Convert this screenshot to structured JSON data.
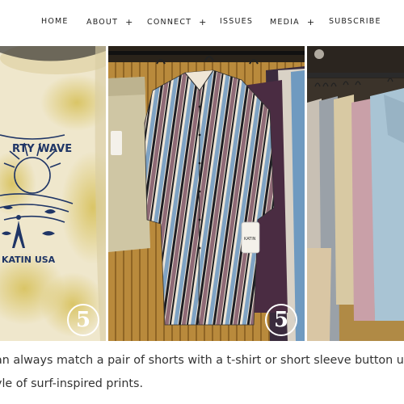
{
  "nav": {
    "items": [
      {
        "label": "HOME",
        "has_submenu": false
      },
      {
        "label": "ABOUT",
        "has_submenu": true
      },
      {
        "label": "CONNECT",
        "has_submenu": true
      },
      {
        "label": "ISSUES",
        "has_submenu": false
      },
      {
        "label": "MEDIA",
        "has_submenu": true
      },
      {
        "label": "SUBSCRIBE",
        "has_submenu": false
      }
    ],
    "submenu_glyph": "+"
  },
  "photos": [
    {
      "alt": "tie-dyed t-shirt",
      "shirt_text_top": "RTY WAVE",
      "shirt_text_bottom": "KATIN USA",
      "badge": "5"
    },
    {
      "alt": "striped button-up shirt on rack",
      "tag_text": "KATIN",
      "badge": "5"
    },
    {
      "alt": "pastel shirts on rack"
    }
  ],
  "caption": {
    "line1": "an always match a pair of shorts with a t-shirt or short sleeve button up that K",
    "line2": "yle of surf-inspired prints."
  },
  "colors": {
    "shirt_cream": "#efe6c8",
    "stain_yellow": "#d8c56b",
    "print_navy": "#1f3566",
    "stripe_blue": "#7fa3c4",
    "stripe_mauve": "#8f6a76",
    "stripe_black": "#1d1d22",
    "wood": "#b98a3c"
  }
}
